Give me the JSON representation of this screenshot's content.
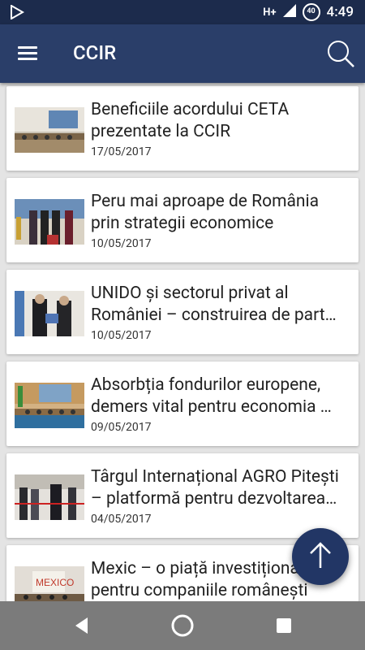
{
  "status_bar": {
    "network_label": "H+",
    "battery_label": "40",
    "time": "4:49"
  },
  "app_bar": {
    "title": "CCIR",
    "menu_icon": "hamburger-menu-icon",
    "search_icon": "search-icon"
  },
  "articles": [
    {
      "title_line1": "Beneficiile acordului CETA",
      "title_line2": "prezentate la CCIR",
      "date": "17/05/2017"
    },
    {
      "title_line1": "Peru mai aproape de România",
      "title_line2": "prin strategii economice",
      "date": "10/05/2017"
    },
    {
      "title_line1": "UNIDO și sectorul privat al",
      "title_line2": "României – construirea de part…",
      "date": "10/05/2017"
    },
    {
      "title_line1": "Absorbția fondurilor europene,",
      "title_line2": "demers vital pentru economia …",
      "date": "09/05/2017"
    },
    {
      "title_line1": "Târgul Internațional AGRO Pitești",
      "title_line2": "– platformă pentru dezvoltarea…",
      "date": "04/05/2017"
    },
    {
      "title_line1": "Mexic – o piață investiționa",
      "title_line2": "pentru companiile românești",
      "date": ""
    }
  ],
  "fab": {
    "icon": "arrow-up-icon"
  },
  "colors": {
    "status_bar": "#1c2b4c",
    "app_bar": "#2a3e69",
    "fab": "#223665",
    "nav_bar": "#7b7b7b"
  }
}
